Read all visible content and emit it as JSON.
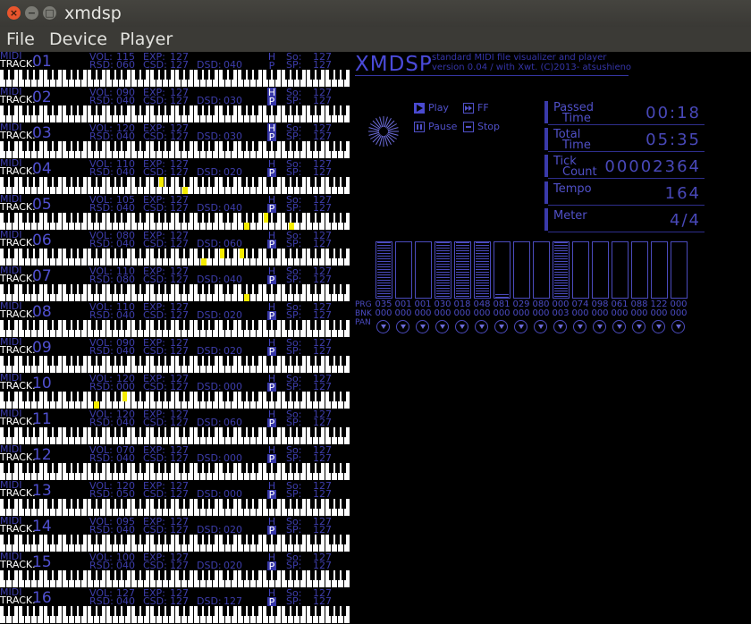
{
  "window": {
    "title": "xmdsp"
  },
  "menu": [
    "File",
    "Device",
    "Player"
  ],
  "app": {
    "name": "XMDSP",
    "subtitle": "standard MIDI file visualizer and player",
    "version": "version 0.04 / with Xwt. (C)2013- atsushieno"
  },
  "track_labels": {
    "midi": "MIDI",
    "track": "TRACK.",
    "vol": "VOL:",
    "exp": "EXP:",
    "rsd": "RSD:",
    "csd": "CSD:",
    "dsd": "DSD:",
    "h": "H",
    "p": "P",
    "so": "So:",
    "sp": "SP:"
  },
  "tracks": [
    {
      "num": "01",
      "vol": "115",
      "exp": "127",
      "rsd": "060",
      "csd": "127",
      "dsd": "040",
      "so": "127",
      "sp": "127",
      "h": false,
      "p": false,
      "notes": []
    },
    {
      "num": "02",
      "vol": "090",
      "exp": "127",
      "rsd": "040",
      "csd": "127",
      "dsd": "030",
      "so": "127",
      "sp": "127",
      "h": true,
      "p": true,
      "notes": []
    },
    {
      "num": "03",
      "vol": "120",
      "exp": "127",
      "rsd": "040",
      "csd": "127",
      "dsd": "030",
      "so": "127",
      "sp": "127",
      "h": true,
      "p": true,
      "notes": []
    },
    {
      "num": "04",
      "vol": "110",
      "exp": "127",
      "rsd": "040",
      "csd": "127",
      "dsd": "020",
      "so": "127",
      "sp": "127",
      "h": false,
      "p": true,
      "notes": [
        [
          178,
          "b"
        ],
        [
          204,
          "w"
        ]
      ]
    },
    {
      "num": "05",
      "vol": "105",
      "exp": "127",
      "rsd": "040",
      "csd": "127",
      "dsd": "040",
      "so": "127",
      "sp": "127",
      "h": false,
      "p": true,
      "notes": [
        [
          273,
          "w"
        ],
        [
          295,
          "b"
        ],
        [
          323,
          "w"
        ]
      ]
    },
    {
      "num": "06",
      "vol": "080",
      "exp": "127",
      "rsd": "040",
      "csd": "127",
      "dsd": "060",
      "so": "127",
      "sp": "127",
      "h": false,
      "p": true,
      "notes": [
        [
          225,
          "w"
        ],
        [
          246,
          "b"
        ],
        [
          268,
          "b"
        ]
      ]
    },
    {
      "num": "07",
      "vol": "110",
      "exp": "127",
      "rsd": "080",
      "csd": "127",
      "dsd": "040",
      "so": "127",
      "sp": "127",
      "h": false,
      "p": true,
      "notes": [
        [
          273,
          "w"
        ]
      ]
    },
    {
      "num": "08",
      "vol": "110",
      "exp": "127",
      "rsd": "040",
      "csd": "127",
      "dsd": "020",
      "so": "127",
      "sp": "127",
      "h": false,
      "p": true,
      "notes": []
    },
    {
      "num": "09",
      "vol": "090",
      "exp": "127",
      "rsd": "040",
      "csd": "127",
      "dsd": "020",
      "so": "127",
      "sp": "127",
      "h": false,
      "p": true,
      "notes": []
    },
    {
      "num": "10",
      "vol": "120",
      "exp": "127",
      "rsd": "000",
      "csd": "127",
      "dsd": "000",
      "so": "127",
      "sp": "127",
      "h": false,
      "p": true,
      "notes": [
        [
          105,
          "w"
        ],
        [
          137,
          "b"
        ]
      ]
    },
    {
      "num": "11",
      "vol": "120",
      "exp": "127",
      "rsd": "040",
      "csd": "127",
      "dsd": "060",
      "so": "127",
      "sp": "127",
      "h": false,
      "p": true,
      "notes": []
    },
    {
      "num": "12",
      "vol": "070",
      "exp": "127",
      "rsd": "040",
      "csd": "127",
      "dsd": "000",
      "so": "127",
      "sp": "127",
      "h": false,
      "p": true,
      "notes": []
    },
    {
      "num": "13",
      "vol": "120",
      "exp": "127",
      "rsd": "050",
      "csd": "127",
      "dsd": "000",
      "so": "127",
      "sp": "127",
      "h": false,
      "p": true,
      "notes": []
    },
    {
      "num": "14",
      "vol": "095",
      "exp": "127",
      "rsd": "040",
      "csd": "127",
      "dsd": "020",
      "so": "127",
      "sp": "127",
      "h": false,
      "p": true,
      "notes": []
    },
    {
      "num": "15",
      "vol": "100",
      "exp": "127",
      "rsd": "040",
      "csd": "127",
      "dsd": "020",
      "so": "127",
      "sp": "127",
      "h": false,
      "p": true,
      "notes": []
    },
    {
      "num": "16",
      "vol": "127",
      "exp": "127",
      "rsd": "040",
      "csd": "127",
      "dsd": "127",
      "so": "127",
      "sp": "127",
      "h": false,
      "p": true,
      "notes": []
    }
  ],
  "controls": {
    "play": "Play",
    "ff": "FF",
    "pause": "Pause",
    "stop": "Stop",
    "active": "play"
  },
  "status": {
    "passed_1": "Passed",
    "passed_2": "Time",
    "passed_value": "00:18",
    "total_1": "Total",
    "total_2": "Time",
    "total_value": "05:35",
    "tick_1": "Tick",
    "tick_2": "Count",
    "tick_value": "00002364",
    "tempo": "Tempo",
    "tempo_value": "164",
    "meter": "Meter",
    "meter_value": "4/4"
  },
  "channel_labels": {
    "prg": "PRG",
    "bnk": "BNK",
    "pan": "PAN"
  },
  "channels": [
    {
      "prg": "035",
      "bnk": "000",
      "level": 1.0
    },
    {
      "prg": "001",
      "bnk": "000",
      "level": 0.0
    },
    {
      "prg": "001",
      "bnk": "000",
      "level": 0.0
    },
    {
      "prg": "030",
      "bnk": "000",
      "level": 1.0
    },
    {
      "prg": "018",
      "bnk": "000",
      "level": 1.0
    },
    {
      "prg": "048",
      "bnk": "000",
      "level": 1.0
    },
    {
      "prg": "081",
      "bnk": "000",
      "level": 0.06
    },
    {
      "prg": "029",
      "bnk": "000",
      "level": 0.0
    },
    {
      "prg": "080",
      "bnk": "000",
      "level": 0.0
    },
    {
      "prg": "000",
      "bnk": "003",
      "level": 1.0
    },
    {
      "prg": "074",
      "bnk": "000",
      "level": 0.0
    },
    {
      "prg": "098",
      "bnk": "000",
      "level": 0.0
    },
    {
      "prg": "061",
      "bnk": "000",
      "level": 0.0
    },
    {
      "prg": "088",
      "bnk": "000",
      "level": 0.0
    },
    {
      "prg": "122",
      "bnk": "000",
      "level": 0.0
    },
    {
      "prg": "000",
      "bnk": "000",
      "level": 0.0
    }
  ]
}
